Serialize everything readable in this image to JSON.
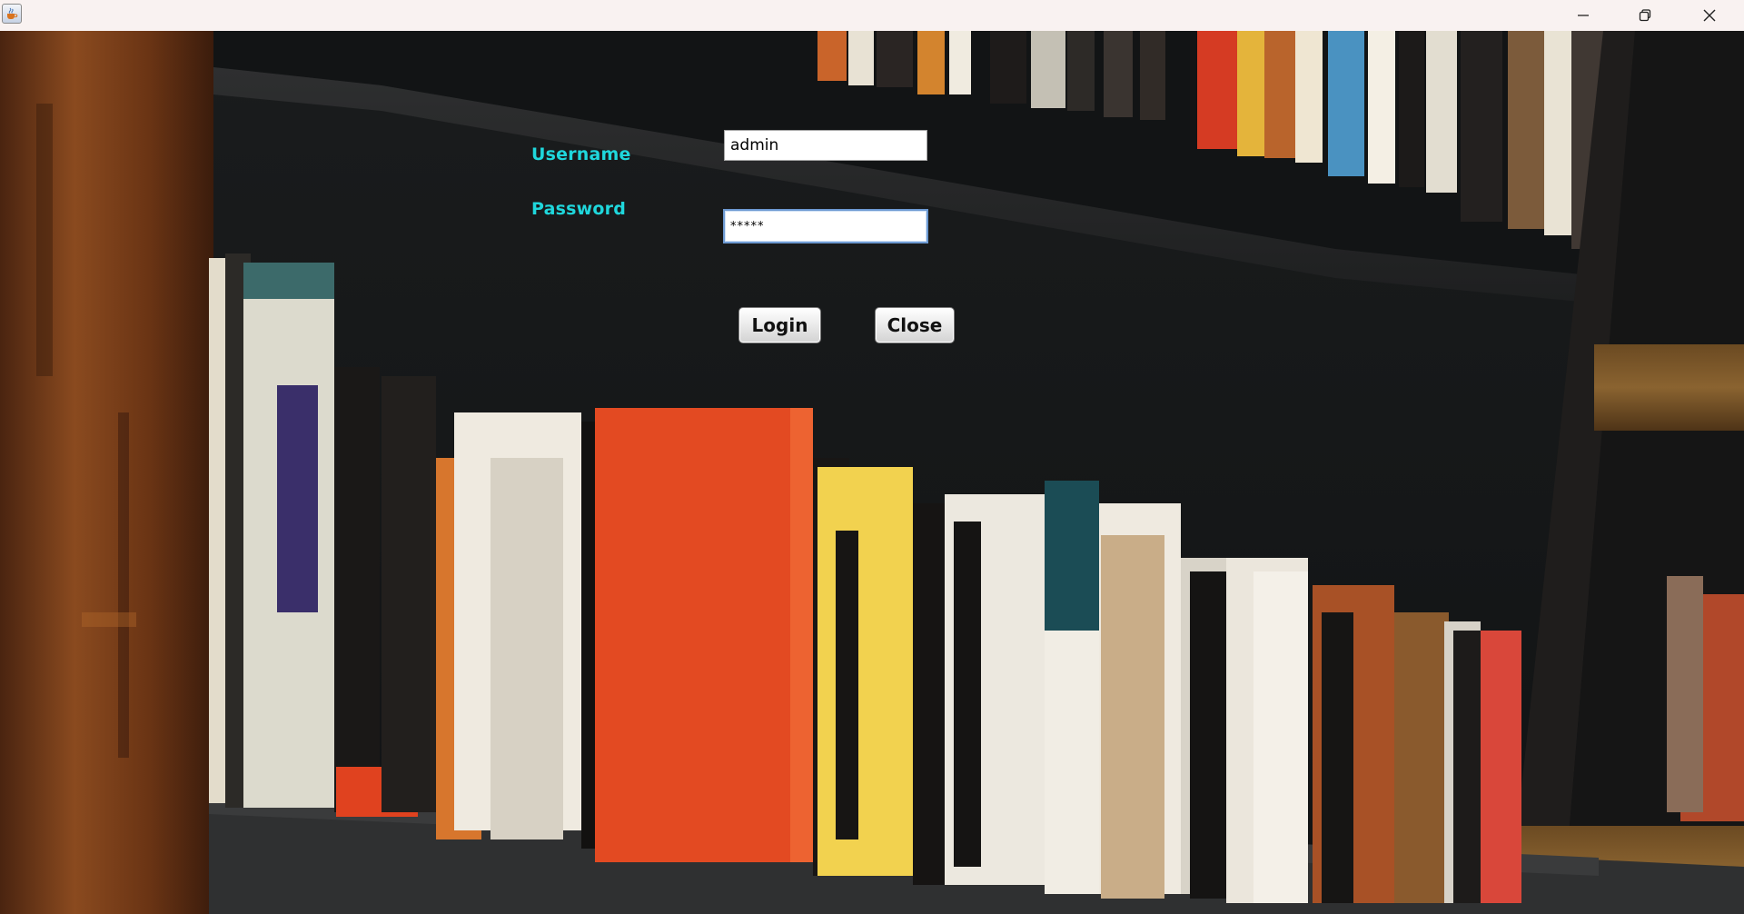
{
  "titlebar": {
    "app_icon": "java-coffee-cup-icon",
    "minimize_icon": "minimize-icon",
    "restore_icon": "restore-icon",
    "close_icon": "close-icon"
  },
  "login": {
    "username_label": "Username",
    "username_value": "admin",
    "password_label": "Password",
    "password_value": "*****",
    "login_button": "Login",
    "close_button": "Close"
  },
  "colors": {
    "label": "#1fd7dc",
    "titlebar": "#f9f2f1"
  }
}
